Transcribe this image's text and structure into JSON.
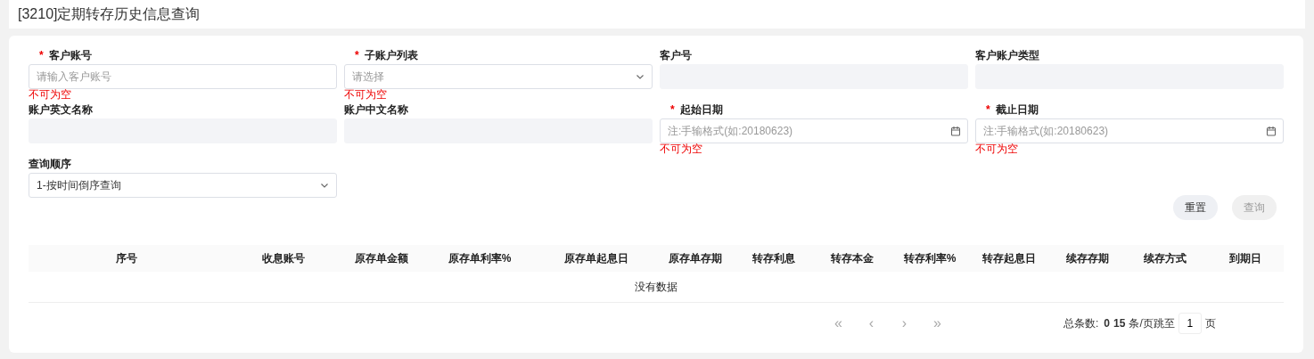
{
  "title": "[3210]定期转存历史信息查询",
  "fields": [
    {
      "label": "客户账号",
      "required_mark": "*",
      "kind": "text",
      "placeholder": "请输入客户账号",
      "error": "不可为空"
    },
    {
      "label": "子账户列表",
      "required_mark": "*",
      "kind": "select",
      "placeholder": "请选择",
      "error": "不可为空"
    },
    {
      "label": "客户号",
      "kind": "readonly"
    },
    {
      "label": "客户账户类型",
      "kind": "readonly"
    },
    {
      "label": "账户英文名称",
      "kind": "readonly"
    },
    {
      "label": "账户中文名称",
      "kind": "readonly"
    },
    {
      "label": "起始日期",
      "required_mark": "*",
      "kind": "date",
      "placeholder": "注:手输格式(如:20180623)",
      "error": "不可为空"
    },
    {
      "label": "截止日期",
      "required_mark": "*",
      "kind": "date",
      "placeholder": "注:手输格式(如:20180623)",
      "error": "不可为空"
    },
    {
      "label": "查询顺序",
      "kind": "select",
      "value": "1-按时间倒序查询"
    }
  ],
  "buttons": [
    {
      "label": "重置",
      "disabled": false
    },
    {
      "label": "查询",
      "disabled": true
    }
  ],
  "table": {
    "columns": [
      "序号",
      "收息账号",
      "原存单金额",
      "原存单利率%",
      "原存单起息日",
      "原存单存期",
      "转存利息",
      "转存本金",
      "转存利率%",
      "转存起息日",
      "续存存期",
      "续存方式",
      "到期日"
    ],
    "empty_text": "没有数据"
  },
  "pagination": {
    "first": "«",
    "prev": "‹",
    "next": "›",
    "last": "»",
    "nav_disabled": true,
    "total_label": "总条数:",
    "total": "0",
    "page_size": "15",
    "jump_label": "条/页跳至",
    "page": "1",
    "page_suffix": "页"
  }
}
